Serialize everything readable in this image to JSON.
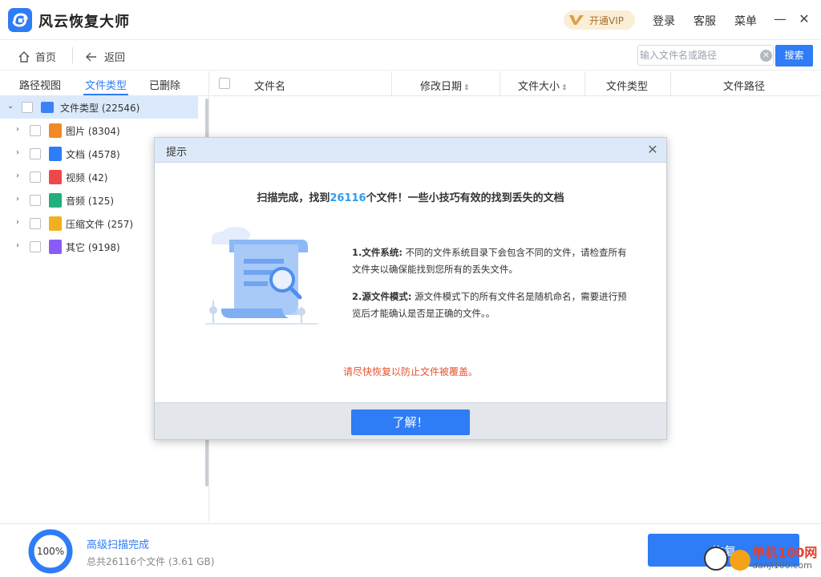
{
  "app": {
    "title": "风云恢复大师",
    "vip_label": "开通VIP",
    "login": "登录",
    "service": "客服",
    "menu": "菜单"
  },
  "toolbar": {
    "home": "首页",
    "back": "返回",
    "search_placeholder": "输入文件名或路径",
    "search_button": "搜索"
  },
  "sidebar": {
    "tabs": [
      "路径视图",
      "文件类型",
      "已删除"
    ],
    "active_tab": "文件类型",
    "tree": [
      {
        "label": "文件类型 (22546)",
        "icon": "drive-icon",
        "color": "#3b82f6"
      },
      {
        "label": "图片 (8304)",
        "icon": "image-icon",
        "color": "#f08a24"
      },
      {
        "label": "文档 (4578)",
        "icon": "document-icon",
        "color": "#2e7cf6"
      },
      {
        "label": "视频 (42)",
        "icon": "video-icon",
        "color": "#f04848"
      },
      {
        "label": "音频 (125)",
        "icon": "audio-icon",
        "color": "#22b07d"
      },
      {
        "label": "压缩文件 (257)",
        "icon": "archive-icon",
        "color": "#f2b01e"
      },
      {
        "label": "其它 (9198)",
        "icon": "other-icon",
        "color": "#8a5cf6"
      }
    ]
  },
  "table": {
    "columns": [
      "文件名",
      "修改日期",
      "文件大小",
      "文件类型",
      "文件路径"
    ]
  },
  "status": {
    "progress": 100,
    "progress_label": "100%",
    "scan_status": "高级扫描完成",
    "scan_total": "总共26116个文件 (3.61 GB)",
    "recover_button": "恢复"
  },
  "modal": {
    "title": "提示",
    "headline_prefix": "扫描完成，找到",
    "headline_count": "26116",
    "headline_suffix": "个文件！一些小技巧有效的找到丢失的文档",
    "tip1_title": "1.文件系统:",
    "tip1_text": " 不同的文件系统目录下会包含不同的文件，请检查所有文件夹以确保能找到您所有的丢失文件。",
    "tip2_title": "2.源文件模式:",
    "tip2_text": " 源文件模式下的所有文件名是随机命名，需要进行预览后才能确认是否是正确的文件。。",
    "warning": "请尽快恢复以防止文件被覆盖。",
    "ok_button": "了解！"
  },
  "watermark": {
    "text": "单机100网",
    "sub": "danji100.com"
  },
  "colors": {
    "accent": "#2e7cf6",
    "warning": "#e8522b",
    "vip_bg": "#fbeed7"
  }
}
